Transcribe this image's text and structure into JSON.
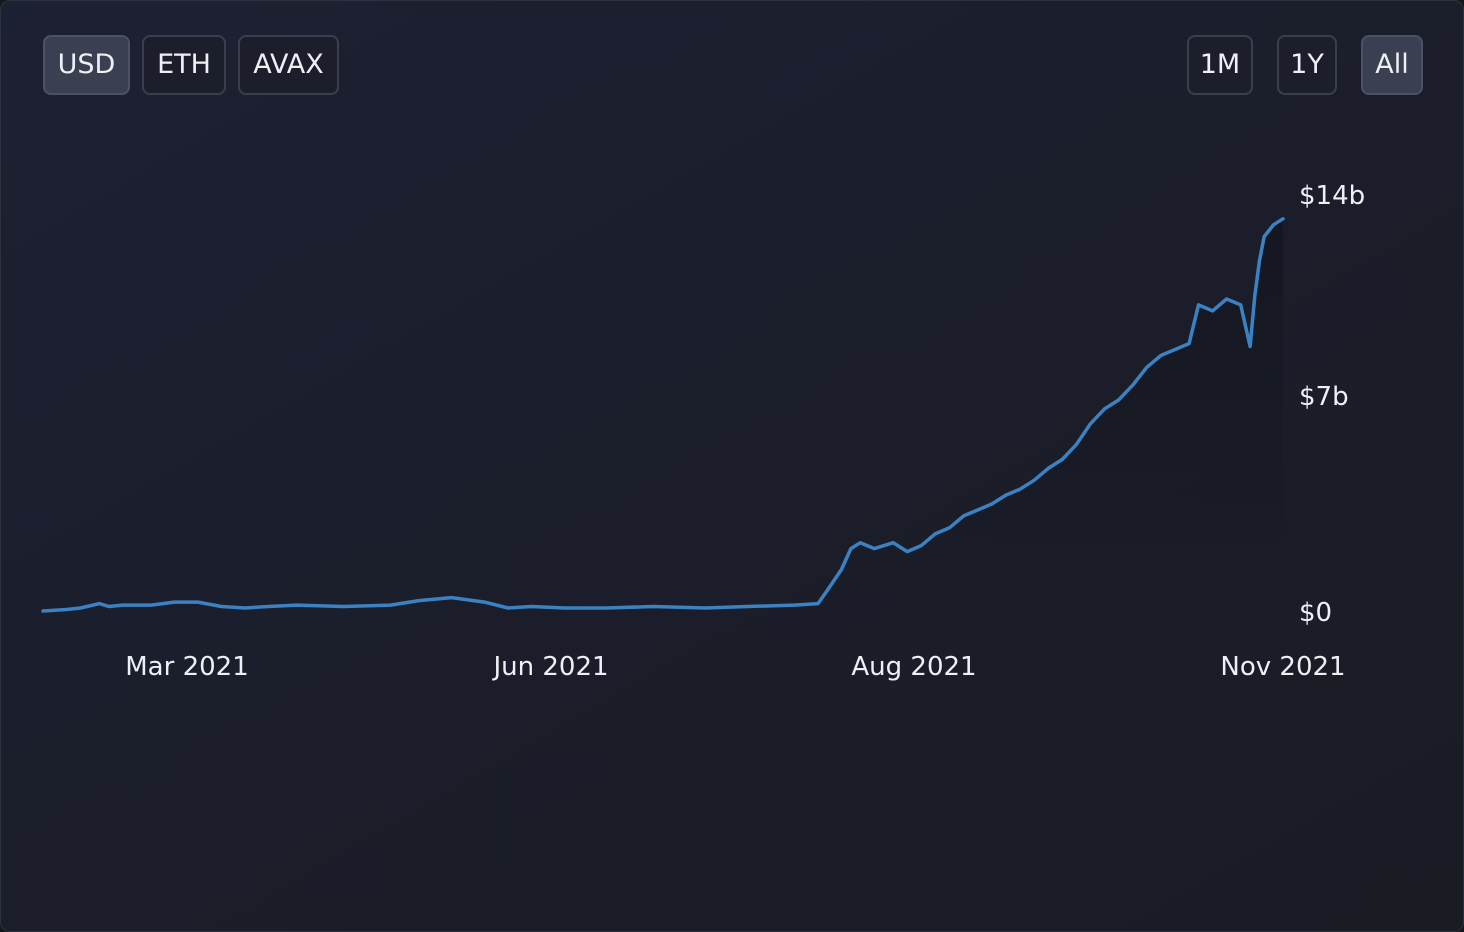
{
  "currency_buttons": [
    {
      "label": "USD",
      "active": true
    },
    {
      "label": "ETH",
      "active": false
    },
    {
      "label": "AVAX",
      "active": false
    }
  ],
  "range_buttons": [
    {
      "label": "1M",
      "active": false
    },
    {
      "label": "1Y",
      "active": false
    },
    {
      "label": "All",
      "active": true
    }
  ],
  "colors": {
    "line": "#3b82c4",
    "active_button": "#3a3f52"
  },
  "chart_data": {
    "type": "line",
    "x_tick_labels": [
      "Mar 2021",
      "Jun 2021",
      "Aug 2021",
      "Nov 2021"
    ],
    "x_ticks": [
      "2021-03-01",
      "2021-06-01",
      "2021-08-01",
      "2021-11-01"
    ],
    "y_tick_labels": [
      "$0",
      "$7b",
      "$14b"
    ],
    "y_ticks": [
      0,
      7,
      14
    ],
    "yunit": "billion USD",
    "ylim": [
      0,
      14
    ],
    "xlim": [
      "2021-02-10",
      "2021-11-01"
    ],
    "grid": false,
    "series": [
      {
        "x": [
          "2021-02-10",
          "2021-02-15",
          "2021-02-18",
          "2021-02-22",
          "2021-02-24",
          "2021-02-27",
          "2021-03-05",
          "2021-03-10",
          "2021-03-15",
          "2021-03-20",
          "2021-03-25",
          "2021-03-30",
          "2021-04-05",
          "2021-04-15",
          "2021-04-25",
          "2021-05-01",
          "2021-05-08",
          "2021-05-15",
          "2021-05-20",
          "2021-05-25",
          "2021-06-01",
          "2021-06-10",
          "2021-06-20",
          "2021-07-01",
          "2021-07-10",
          "2021-07-20",
          "2021-07-25",
          "2021-07-27",
          "2021-07-30",
          "2021-08-01",
          "2021-08-03",
          "2021-08-06",
          "2021-08-10",
          "2021-08-13",
          "2021-08-16",
          "2021-08-19",
          "2021-08-22",
          "2021-08-25",
          "2021-08-28",
          "2021-08-31",
          "2021-09-03",
          "2021-09-06",
          "2021-09-09",
          "2021-09-12",
          "2021-09-15",
          "2021-09-18",
          "2021-09-21",
          "2021-09-24",
          "2021-09-27",
          "2021-09-30",
          "2021-10-03",
          "2021-10-06",
          "2021-10-09",
          "2021-10-12",
          "2021-10-14",
          "2021-10-17",
          "2021-10-20",
          "2021-10-23",
          "2021-10-25",
          "2021-10-26",
          "2021-10-27",
          "2021-10-28",
          "2021-10-30",
          "2021-11-01"
        ],
        "y": [
          0.0,
          0.05,
          0.1,
          0.25,
          0.15,
          0.2,
          0.2,
          0.3,
          0.3,
          0.15,
          0.1,
          0.15,
          0.2,
          0.15,
          0.2,
          0.35,
          0.45,
          0.3,
          0.1,
          0.15,
          0.1,
          0.1,
          0.15,
          0.1,
          0.15,
          0.2,
          0.25,
          0.7,
          1.4,
          2.1,
          2.3,
          2.1,
          2.3,
          2.0,
          2.2,
          2.6,
          2.8,
          3.2,
          3.4,
          3.6,
          3.9,
          4.1,
          4.4,
          4.8,
          5.1,
          5.6,
          6.3,
          6.8,
          7.1,
          7.6,
          8.2,
          8.6,
          8.8,
          9.0,
          10.3,
          10.1,
          10.5,
          10.3,
          8.9,
          10.6,
          11.8,
          12.6,
          13.0,
          13.2
        ]
      }
    ]
  }
}
